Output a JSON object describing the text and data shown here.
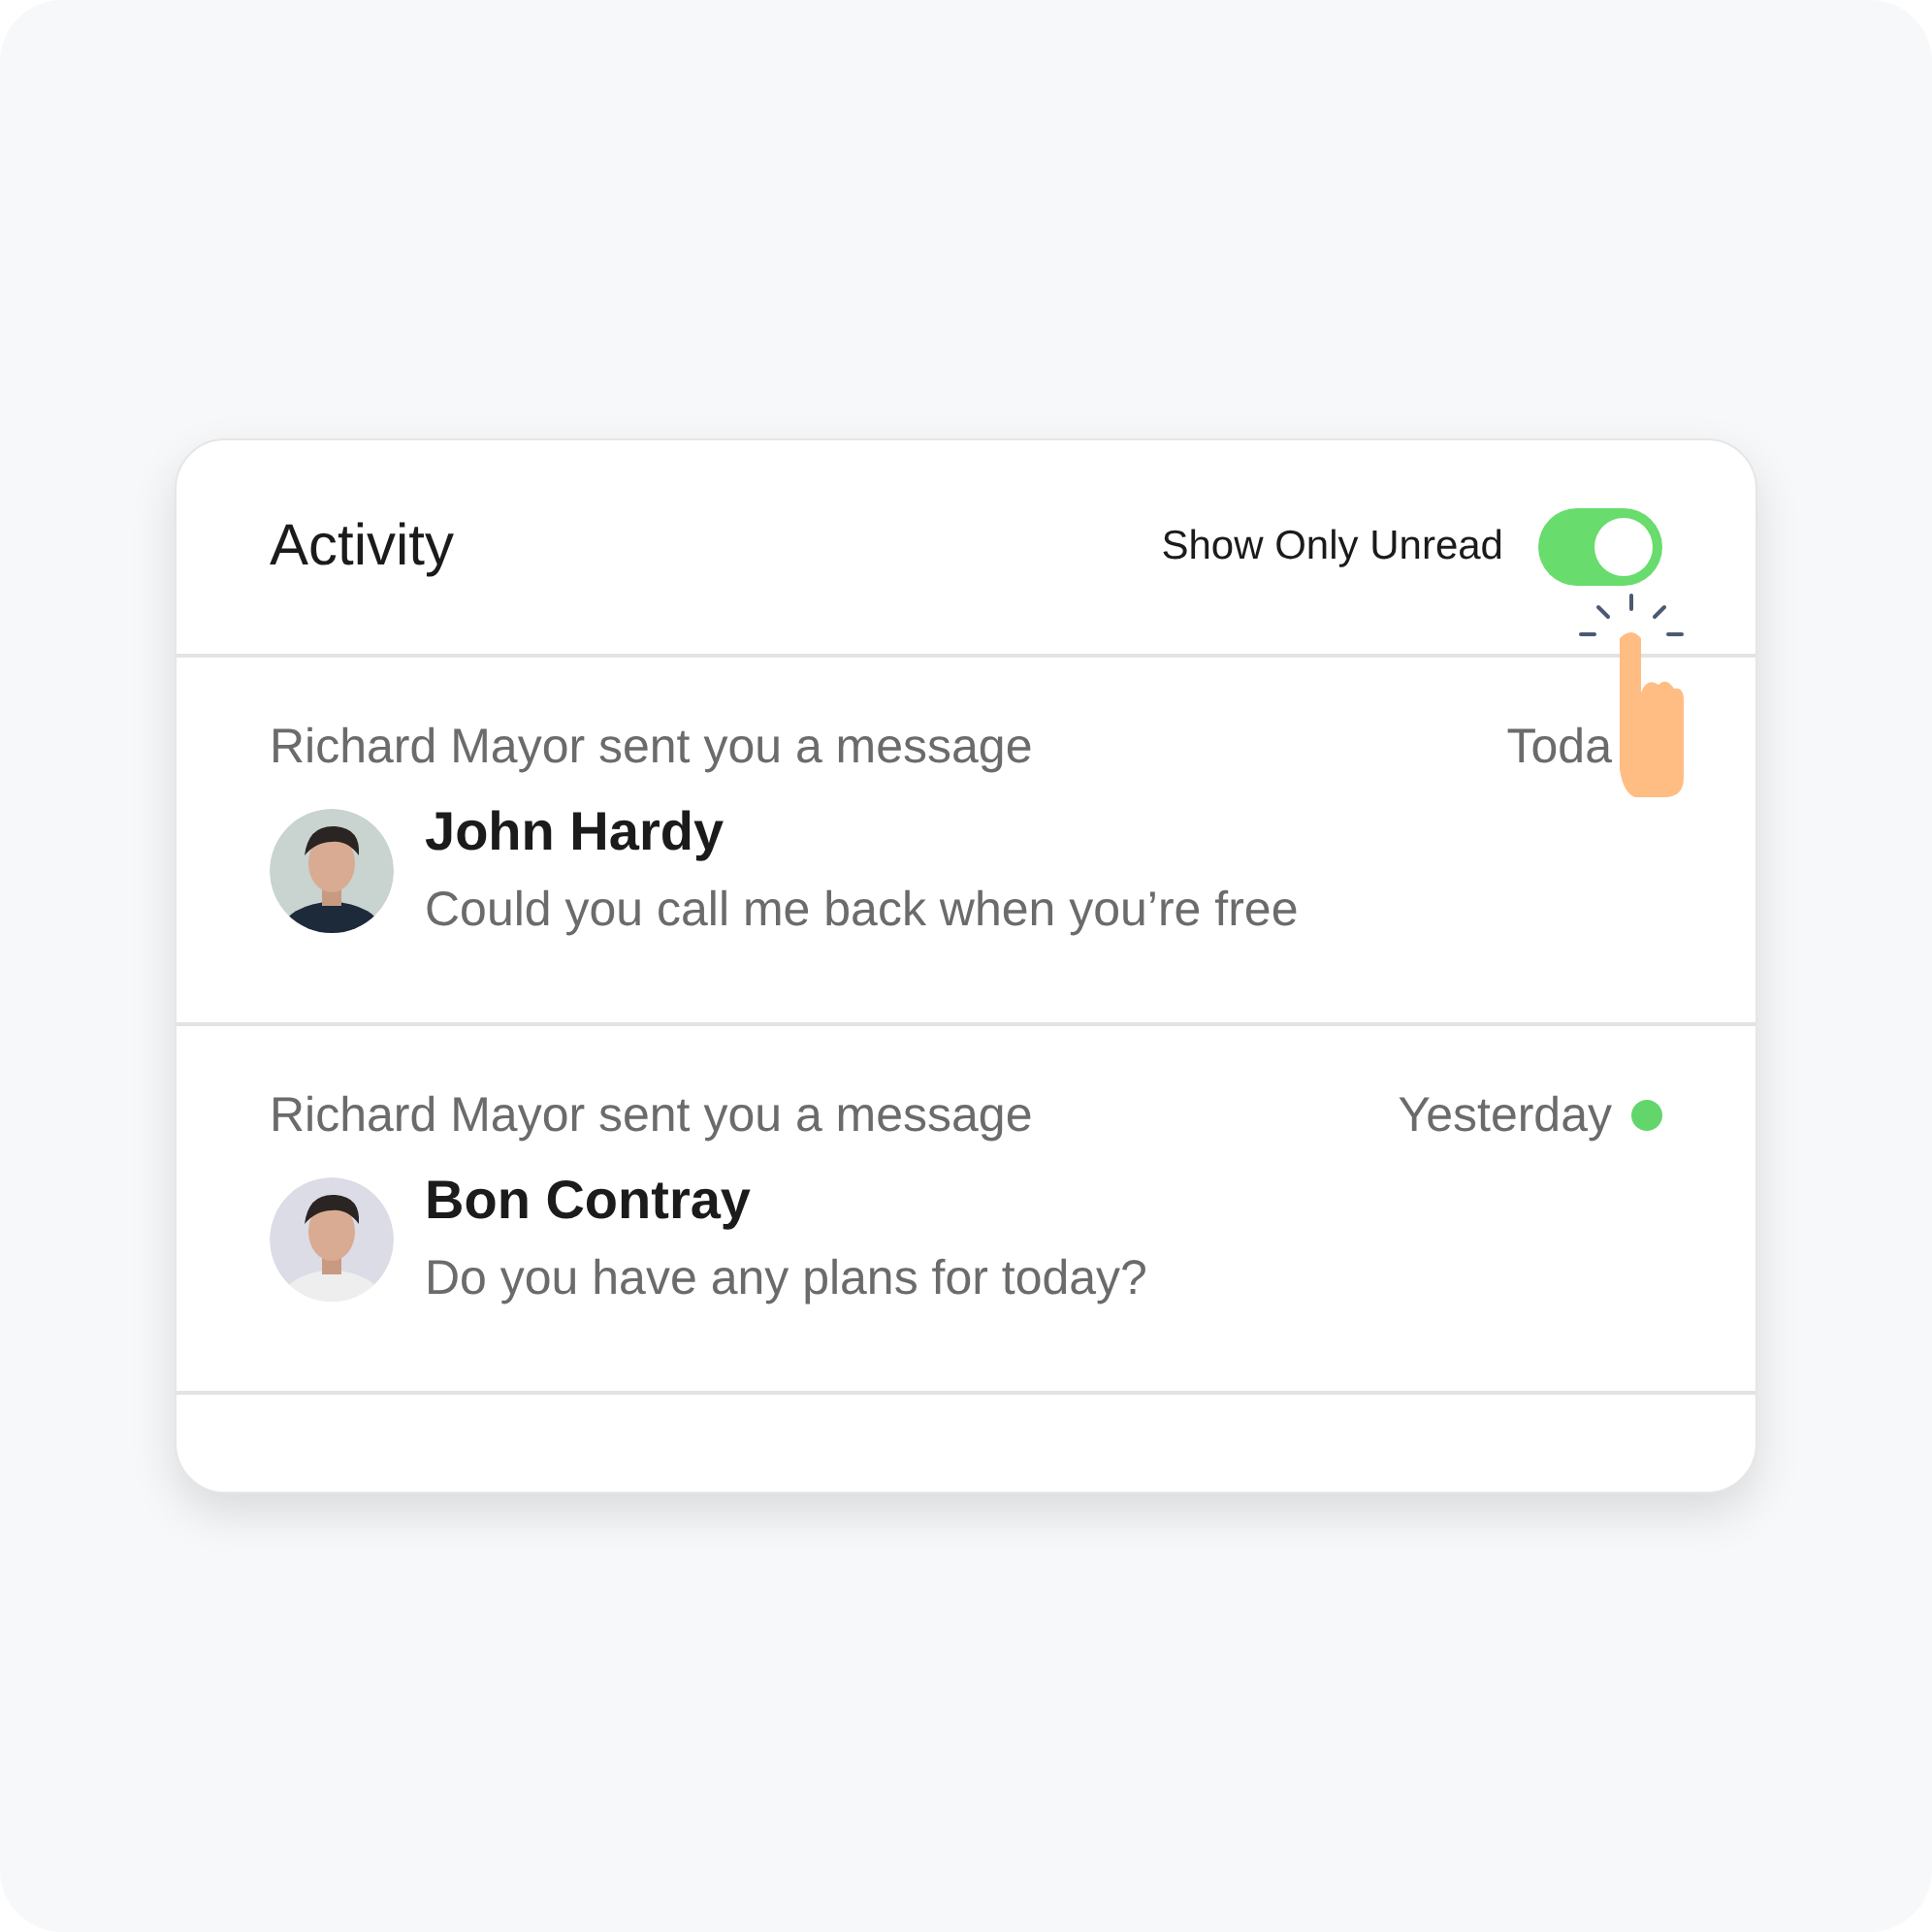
{
  "header": {
    "title": "Activity",
    "filter": {
      "label": "Show Only Unread",
      "on": true
    }
  },
  "items": [
    {
      "summary": "Richard Mayor sent you a message",
      "time": "Toda",
      "sender": "John Hardy",
      "message": "Could you call me back when you’re free"
    },
    {
      "summary": "Richard Mayor sent you a message",
      "time": "Yesterday",
      "unread": true,
      "sender": "Bon Contray",
      "message": "Do you have any plans for today?"
    }
  ]
}
